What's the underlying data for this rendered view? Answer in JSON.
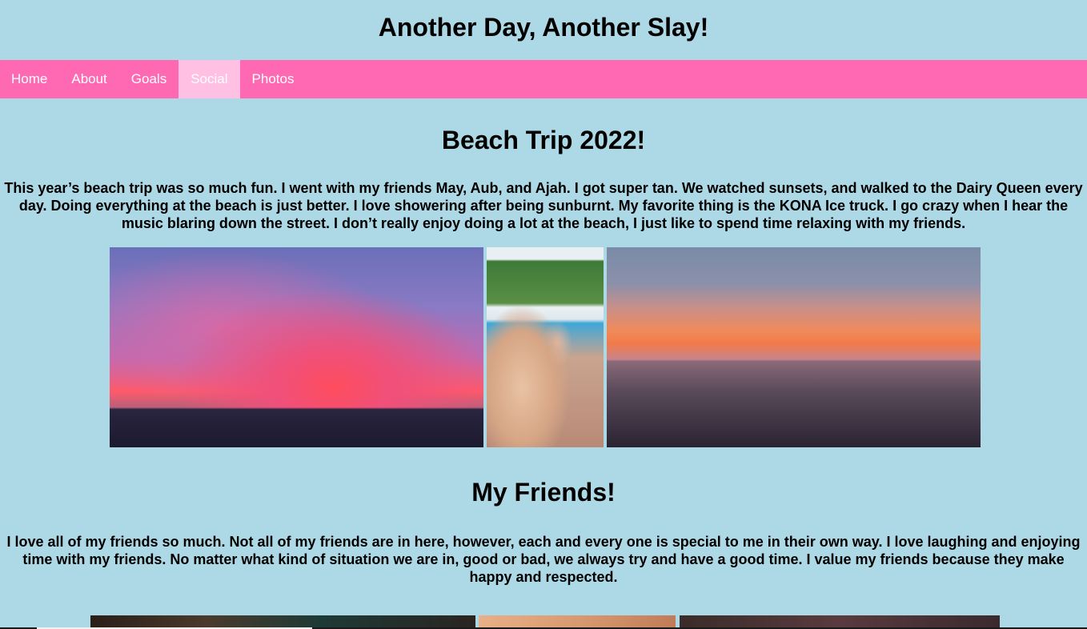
{
  "site": {
    "title": "Another Day, Another Slay!"
  },
  "nav": {
    "items": [
      {
        "label": "Home"
      },
      {
        "label": "About"
      },
      {
        "label": "Goals"
      },
      {
        "label": "Social"
      },
      {
        "label": "Photos"
      }
    ],
    "active": "Social"
  },
  "beach": {
    "title": "Beach Trip 2022!",
    "text": "This year’s beach trip was so much fun. I went with my friends May, Aub, and Ajah. I got super tan. We watched sunsets, and walked to the Dairy Queen every day. Doing everything at the beach is just better. I love showering after being sunburnt. My favorite thing is the KONA Ice truck. I go crazy when I hear the music blaring down the street. I don’t really enjoy doing a lot at the beach, I just like to spend time relaxing with my friends."
  },
  "friends": {
    "title": "My Friends!",
    "text": "I love all of my friends so much. Not all of my friends are in here, however, each and every one is special to me in their own way. I love laughing and enjoying time with my friends. No matter what kind of situation we are in, good or bad, we always try and have a good time. I value my friends because they make happy and respected."
  },
  "colors": {
    "background": "#add8e6",
    "nav_bar": "#ff69b4",
    "nav_active": "#ffc0e3"
  }
}
